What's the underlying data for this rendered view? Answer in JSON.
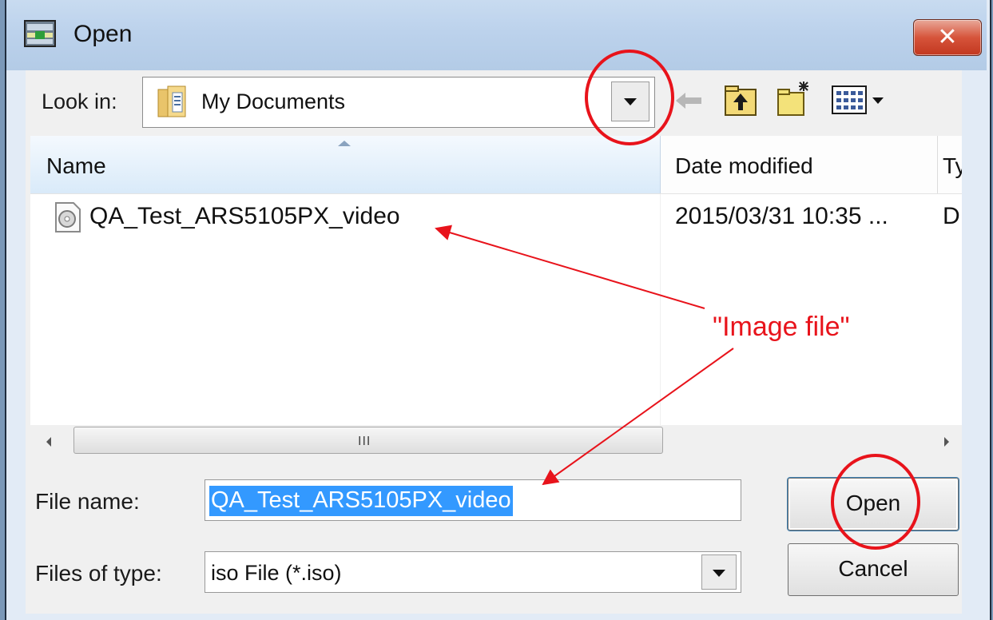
{
  "window": {
    "title": "Open"
  },
  "look_in": {
    "label": "Look in:",
    "value": "My Documents"
  },
  "list": {
    "columns": [
      "Name",
      "Date modified",
      "Ty"
    ],
    "rows": [
      {
        "name": "QA_Test_ARS5105PX_video",
        "date": "2015/03/31 10:35 ...",
        "type": "Di"
      }
    ]
  },
  "scrollbar": {
    "grip": "III"
  },
  "file_name": {
    "label": "File name:",
    "value": "QA_Test_ARS5105PX_video"
  },
  "file_type": {
    "label": "Files of type:",
    "value": "iso File (*.iso)"
  },
  "buttons": {
    "open": "Open",
    "cancel": "Cancel"
  },
  "annotation": {
    "label": "\"Image file\"",
    "color": "#e8131b"
  },
  "colors": {
    "selection": "#3399ff",
    "titlebar": "#bcd2ec",
    "close": "#d6543b"
  }
}
